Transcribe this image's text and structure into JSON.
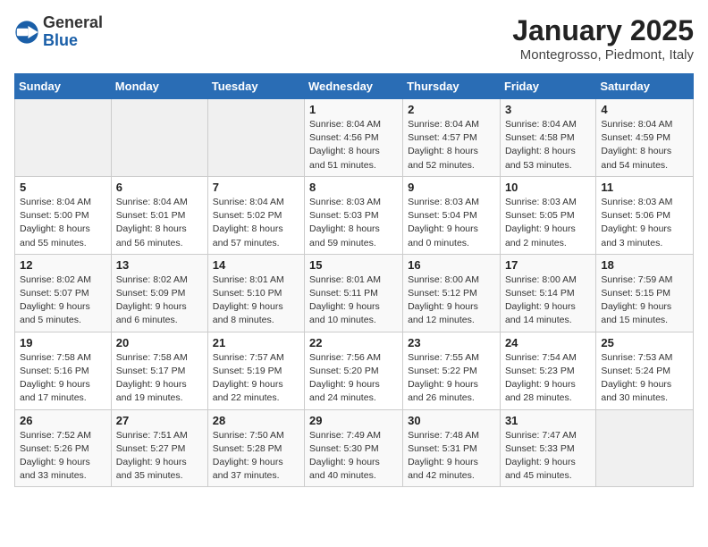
{
  "header": {
    "logo_general": "General",
    "logo_blue": "Blue",
    "title": "January 2025",
    "subtitle": "Montegrosso, Piedmont, Italy"
  },
  "days_of_week": [
    "Sunday",
    "Monday",
    "Tuesday",
    "Wednesday",
    "Thursday",
    "Friday",
    "Saturday"
  ],
  "weeks": [
    [
      {
        "day": "",
        "info": ""
      },
      {
        "day": "",
        "info": ""
      },
      {
        "day": "",
        "info": ""
      },
      {
        "day": "1",
        "info": "Sunrise: 8:04 AM\nSunset: 4:56 PM\nDaylight: 8 hours\nand 51 minutes."
      },
      {
        "day": "2",
        "info": "Sunrise: 8:04 AM\nSunset: 4:57 PM\nDaylight: 8 hours\nand 52 minutes."
      },
      {
        "day": "3",
        "info": "Sunrise: 8:04 AM\nSunset: 4:58 PM\nDaylight: 8 hours\nand 53 minutes."
      },
      {
        "day": "4",
        "info": "Sunrise: 8:04 AM\nSunset: 4:59 PM\nDaylight: 8 hours\nand 54 minutes."
      }
    ],
    [
      {
        "day": "5",
        "info": "Sunrise: 8:04 AM\nSunset: 5:00 PM\nDaylight: 8 hours\nand 55 minutes."
      },
      {
        "day": "6",
        "info": "Sunrise: 8:04 AM\nSunset: 5:01 PM\nDaylight: 8 hours\nand 56 minutes."
      },
      {
        "day": "7",
        "info": "Sunrise: 8:04 AM\nSunset: 5:02 PM\nDaylight: 8 hours\nand 57 minutes."
      },
      {
        "day": "8",
        "info": "Sunrise: 8:03 AM\nSunset: 5:03 PM\nDaylight: 8 hours\nand 59 minutes."
      },
      {
        "day": "9",
        "info": "Sunrise: 8:03 AM\nSunset: 5:04 PM\nDaylight: 9 hours\nand 0 minutes."
      },
      {
        "day": "10",
        "info": "Sunrise: 8:03 AM\nSunset: 5:05 PM\nDaylight: 9 hours\nand 2 minutes."
      },
      {
        "day": "11",
        "info": "Sunrise: 8:03 AM\nSunset: 5:06 PM\nDaylight: 9 hours\nand 3 minutes."
      }
    ],
    [
      {
        "day": "12",
        "info": "Sunrise: 8:02 AM\nSunset: 5:07 PM\nDaylight: 9 hours\nand 5 minutes."
      },
      {
        "day": "13",
        "info": "Sunrise: 8:02 AM\nSunset: 5:09 PM\nDaylight: 9 hours\nand 6 minutes."
      },
      {
        "day": "14",
        "info": "Sunrise: 8:01 AM\nSunset: 5:10 PM\nDaylight: 9 hours\nand 8 minutes."
      },
      {
        "day": "15",
        "info": "Sunrise: 8:01 AM\nSunset: 5:11 PM\nDaylight: 9 hours\nand 10 minutes."
      },
      {
        "day": "16",
        "info": "Sunrise: 8:00 AM\nSunset: 5:12 PM\nDaylight: 9 hours\nand 12 minutes."
      },
      {
        "day": "17",
        "info": "Sunrise: 8:00 AM\nSunset: 5:14 PM\nDaylight: 9 hours\nand 14 minutes."
      },
      {
        "day": "18",
        "info": "Sunrise: 7:59 AM\nSunset: 5:15 PM\nDaylight: 9 hours\nand 15 minutes."
      }
    ],
    [
      {
        "day": "19",
        "info": "Sunrise: 7:58 AM\nSunset: 5:16 PM\nDaylight: 9 hours\nand 17 minutes."
      },
      {
        "day": "20",
        "info": "Sunrise: 7:58 AM\nSunset: 5:17 PM\nDaylight: 9 hours\nand 19 minutes."
      },
      {
        "day": "21",
        "info": "Sunrise: 7:57 AM\nSunset: 5:19 PM\nDaylight: 9 hours\nand 22 minutes."
      },
      {
        "day": "22",
        "info": "Sunrise: 7:56 AM\nSunset: 5:20 PM\nDaylight: 9 hours\nand 24 minutes."
      },
      {
        "day": "23",
        "info": "Sunrise: 7:55 AM\nSunset: 5:22 PM\nDaylight: 9 hours\nand 26 minutes."
      },
      {
        "day": "24",
        "info": "Sunrise: 7:54 AM\nSunset: 5:23 PM\nDaylight: 9 hours\nand 28 minutes."
      },
      {
        "day": "25",
        "info": "Sunrise: 7:53 AM\nSunset: 5:24 PM\nDaylight: 9 hours\nand 30 minutes."
      }
    ],
    [
      {
        "day": "26",
        "info": "Sunrise: 7:52 AM\nSunset: 5:26 PM\nDaylight: 9 hours\nand 33 minutes."
      },
      {
        "day": "27",
        "info": "Sunrise: 7:51 AM\nSunset: 5:27 PM\nDaylight: 9 hours\nand 35 minutes."
      },
      {
        "day": "28",
        "info": "Sunrise: 7:50 AM\nSunset: 5:28 PM\nDaylight: 9 hours\nand 37 minutes."
      },
      {
        "day": "29",
        "info": "Sunrise: 7:49 AM\nSunset: 5:30 PM\nDaylight: 9 hours\nand 40 minutes."
      },
      {
        "day": "30",
        "info": "Sunrise: 7:48 AM\nSunset: 5:31 PM\nDaylight: 9 hours\nand 42 minutes."
      },
      {
        "day": "31",
        "info": "Sunrise: 7:47 AM\nSunset: 5:33 PM\nDaylight: 9 hours\nand 45 minutes."
      },
      {
        "day": "",
        "info": ""
      }
    ]
  ]
}
